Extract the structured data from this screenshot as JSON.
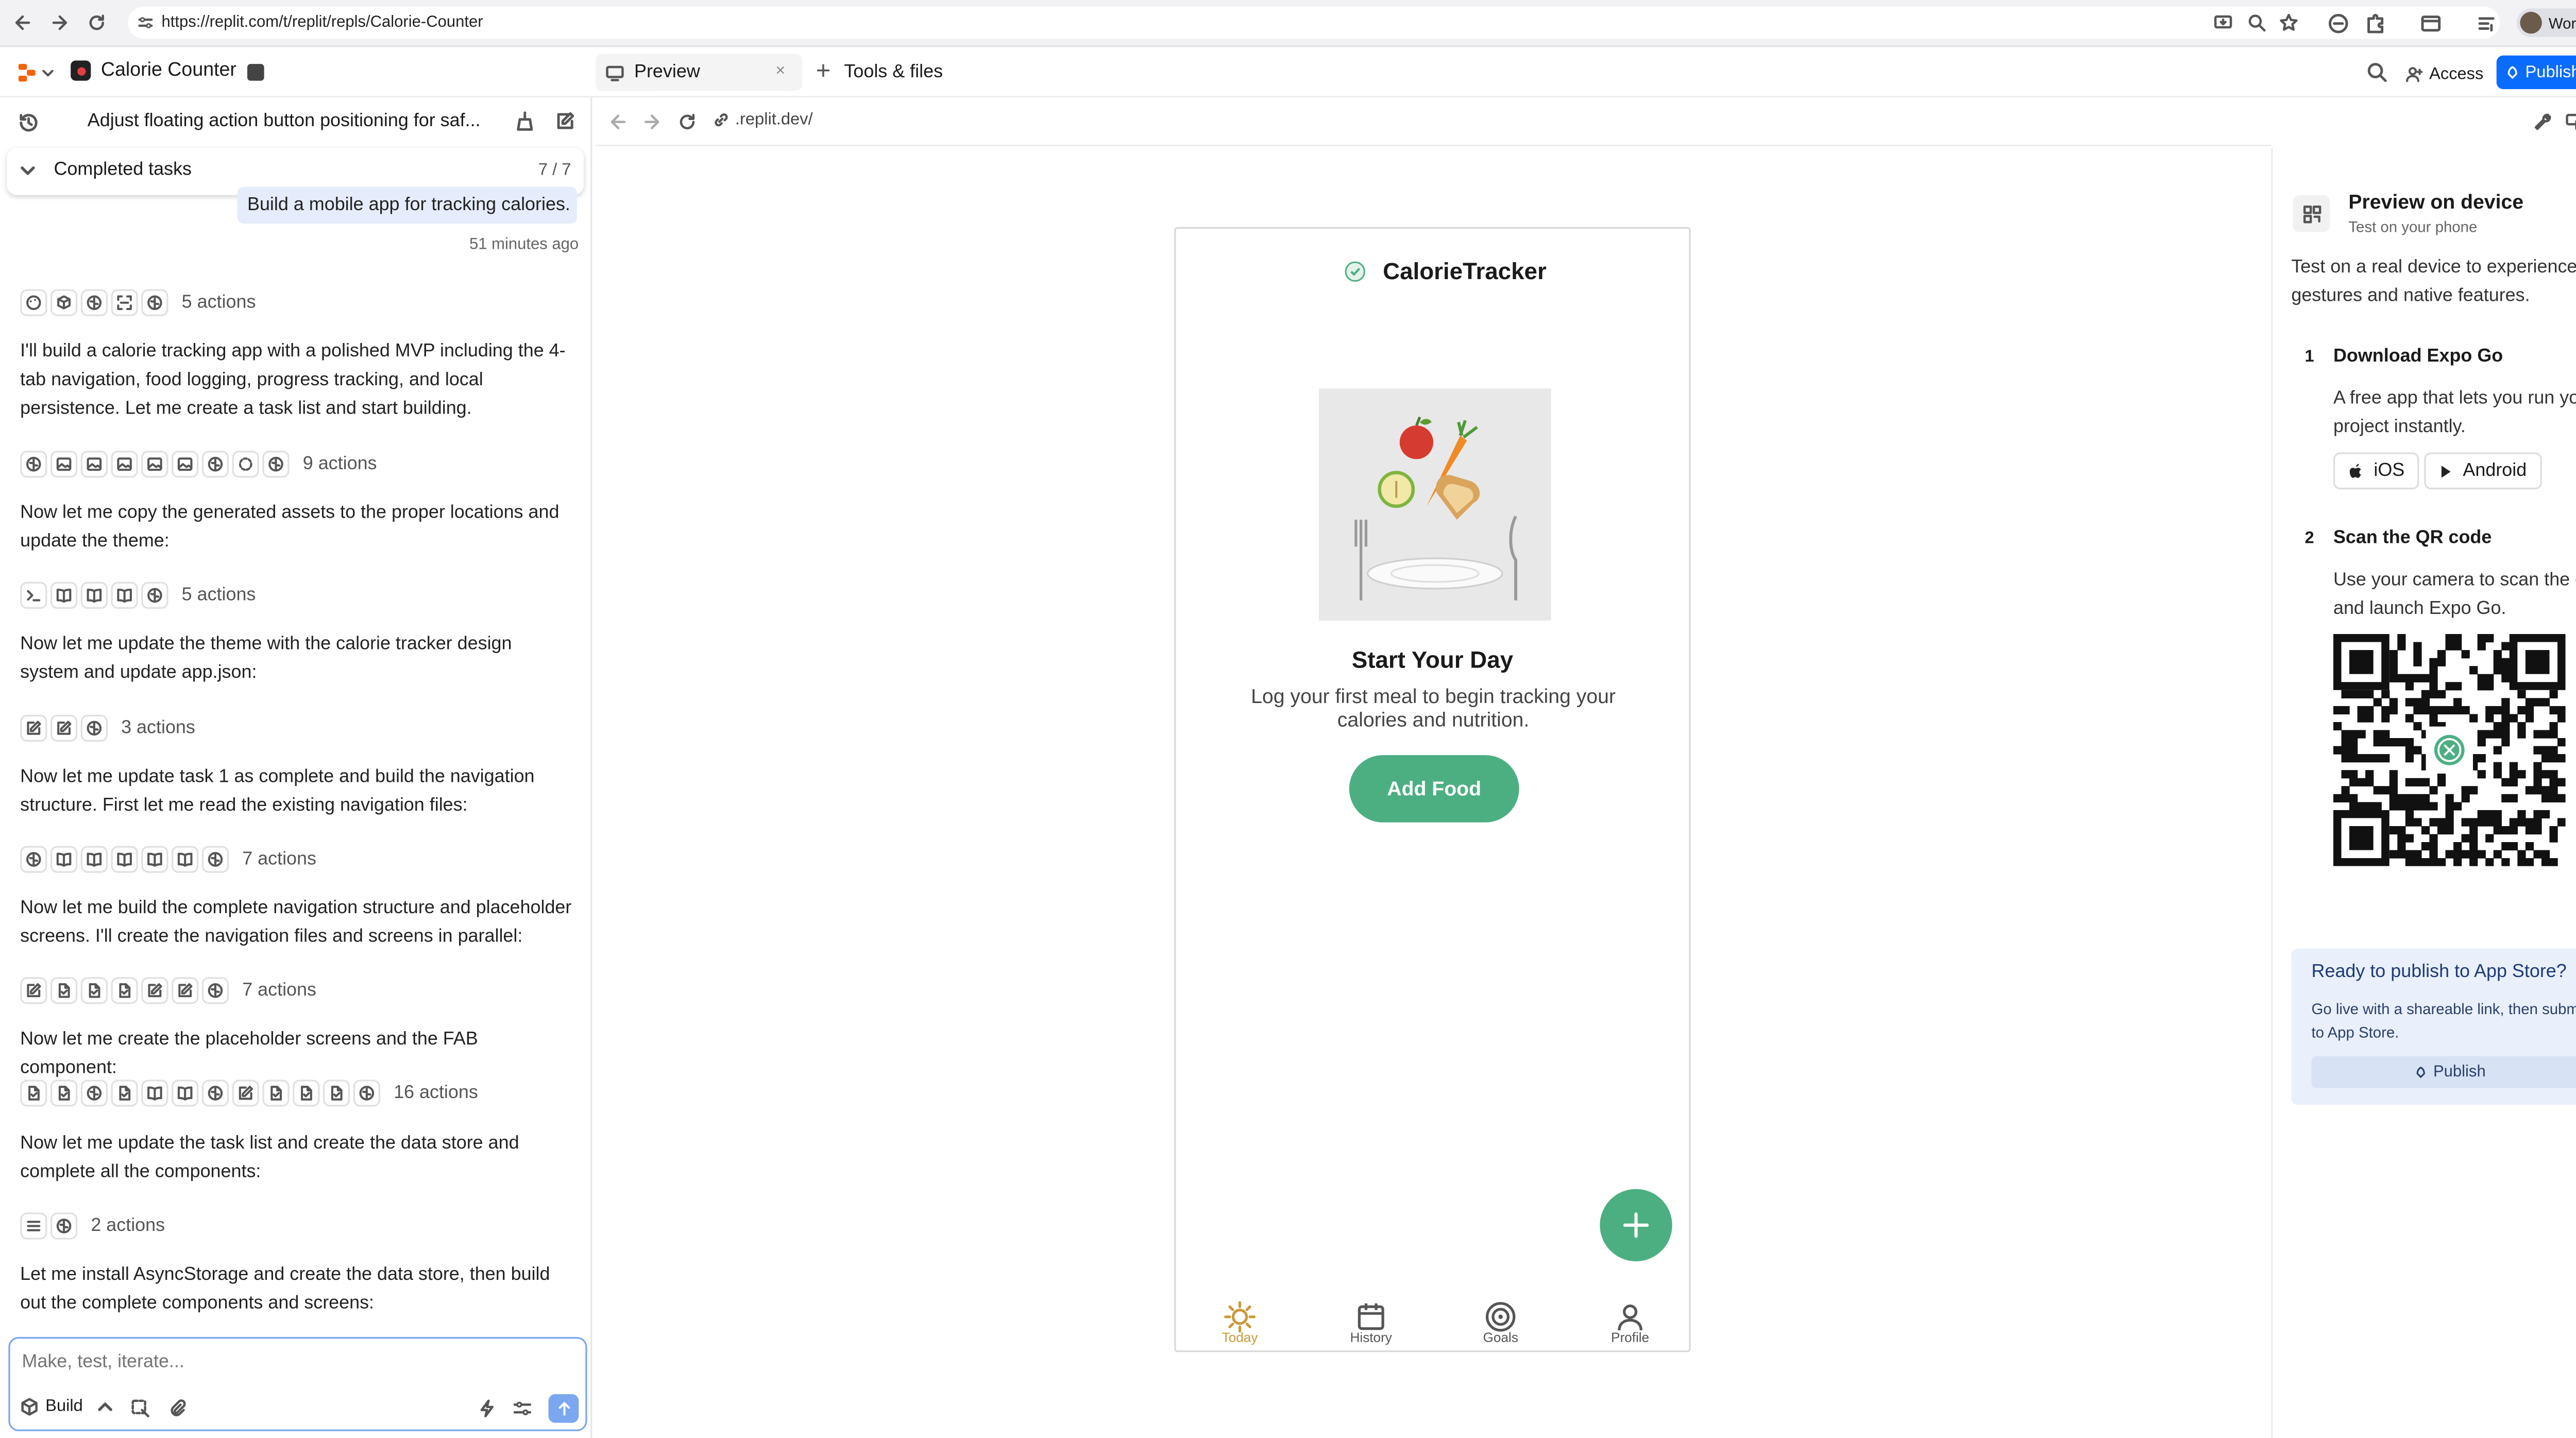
{
  "browser": {
    "url": "https://replit.com/t/replit/repls/Calorie-Counter",
    "profile": "Work"
  },
  "header": {
    "project": "Calorie Counter",
    "tab_preview": "Preview",
    "tab_tools": "Tools & files",
    "access": "Access",
    "publish": "Publish"
  },
  "chat": {
    "thread_title": "Adjust floating action button positioning for saf...",
    "tasks_label": "Completed tasks",
    "tasks_count": "7 / 7",
    "user_message": "Build a mobile app for tracking calories.",
    "timestamp": "51 minutes ago",
    "items": [
      {
        "type": "actions",
        "label": "5 actions",
        "icons": [
          "palette",
          "cube",
          "brain",
          "scan",
          "brain"
        ]
      },
      {
        "type": "text",
        "text": "I'll build a calorie tracking app with a polished MVP including the 4-tab navigation, food logging, progress tracking, and local persistence. Let me create a task list and start building."
      },
      {
        "type": "actions",
        "label": "9 actions",
        "icons": [
          "brain",
          "image",
          "image",
          "image",
          "image",
          "image",
          "brain",
          "spinner",
          "brain"
        ]
      },
      {
        "type": "text",
        "text": "Now let me copy the generated assets to the proper locations and update the theme:"
      },
      {
        "type": "actions",
        "label": "5 actions",
        "icons": [
          "terminal",
          "book",
          "book",
          "book",
          "brain"
        ]
      },
      {
        "type": "text",
        "text": "Now let me update the theme with the calorie tracker design system and update app.json:"
      },
      {
        "type": "actions",
        "label": "3 actions",
        "icons": [
          "edit",
          "edit",
          "brain"
        ]
      },
      {
        "type": "text",
        "text": "Now let me update task 1 as complete and build the navigation structure. First let me read the existing navigation files:"
      },
      {
        "type": "actions",
        "label": "7 actions",
        "icons": [
          "brain",
          "book",
          "book",
          "book",
          "book",
          "book",
          "brain"
        ]
      },
      {
        "type": "text",
        "text": "Now let me build the complete navigation structure and placeholder screens. I'll create the navigation files and screens in parallel:"
      },
      {
        "type": "actions",
        "label": "7 actions",
        "icons": [
          "edit",
          "file",
          "file",
          "file",
          "edit",
          "edit",
          "brain"
        ]
      },
      {
        "type": "text",
        "text": "Now let me create the placeholder screens and the FAB component:"
      },
      {
        "type": "actions",
        "label": "16 actions",
        "icons": [
          "file",
          "file",
          "brain",
          "file",
          "book",
          "book",
          "brain",
          "edit",
          "file",
          "file",
          "file",
          "brain"
        ]
      },
      {
        "type": "text",
        "text": "Now let me update the task list and create the data store and complete all the components:"
      },
      {
        "type": "actions",
        "label": "2 actions",
        "icons": [
          "list",
          "brain"
        ]
      },
      {
        "type": "text",
        "text": "Let me install AsyncStorage and create the data store, then build out the complete components and screens:"
      }
    ],
    "input_placeholder": "Make, test, iterate...",
    "mode_label": "Build"
  },
  "preview": {
    "address": ".replit.dev/"
  },
  "app": {
    "title": "CalorieTracker",
    "heading": "Start Your Day",
    "subtitle": "Log your first meal to begin tracking your calories and nutrition.",
    "cta": "Add Food",
    "tabs": [
      {
        "label": "Today",
        "icon": "sun-icon",
        "active": true
      },
      {
        "label": "History",
        "icon": "calendar-icon"
      },
      {
        "label": "Goals",
        "icon": "target-icon"
      },
      {
        "label": "Profile",
        "icon": "user-icon"
      }
    ]
  },
  "device": {
    "title": "Preview on device",
    "subtitle": "Test on your phone",
    "intro": "Test on a real device to experience touch gestures and native features.",
    "step1_num": "1",
    "step1_title": "Download Expo Go",
    "step1_desc": "A free app that lets you run your project instantly.",
    "ios": "iOS",
    "android": "Android",
    "step2_num": "2",
    "step2_title": "Scan the QR code",
    "step2_desc": "Use your camera to scan the code and launch Expo Go.",
    "publish_title": "Ready to publish to App Store?",
    "publish_desc": "Go live with a shareable link, then submit to App Store.",
    "publish_btn": "Publish"
  },
  "colors": {
    "accent": "#0a6cff",
    "app_green": "#4caf82",
    "tab_active": "#c99a3a",
    "user_bubble": "#e5ecfb"
  }
}
